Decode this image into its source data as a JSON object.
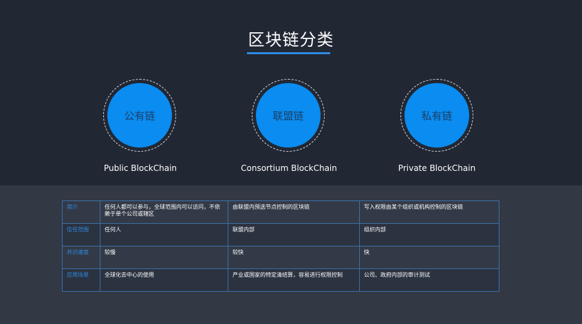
{
  "title": "区块链分类",
  "categories": [
    {
      "circle_label": "公有链",
      "name": "Public BlockChain"
    },
    {
      "circle_label": "联盟链",
      "name": "Consortium BlockChain"
    },
    {
      "circle_label": "私有链",
      "name": "Private BlockChain"
    }
  ],
  "table": {
    "rows": [
      {
        "header": "简介",
        "cells": [
          "任何人都可以参与，全球范围内可以访问，不依赖于单个公司或辖区",
          "由联盟内预选节点控制的区块链",
          "写入权限由某个组织或机构控制的区块链"
        ]
      },
      {
        "header": "信任范围",
        "cells": [
          "任何人",
          "联盟内部",
          "组织内部"
        ]
      },
      {
        "header": "共识速度",
        "cells": [
          "较慢",
          "较快",
          "快"
        ]
      },
      {
        "header": "应用场景",
        "cells": [
          "全球化去中心的使用",
          "产业或国家的特定清结算，容易进行权限控制",
          "公司、政府内部的审计测试"
        ]
      }
    ]
  },
  "colors": {
    "accent": "#0a8cf0",
    "header_text": "#2e8ae0",
    "border": "#3c6fa8"
  }
}
